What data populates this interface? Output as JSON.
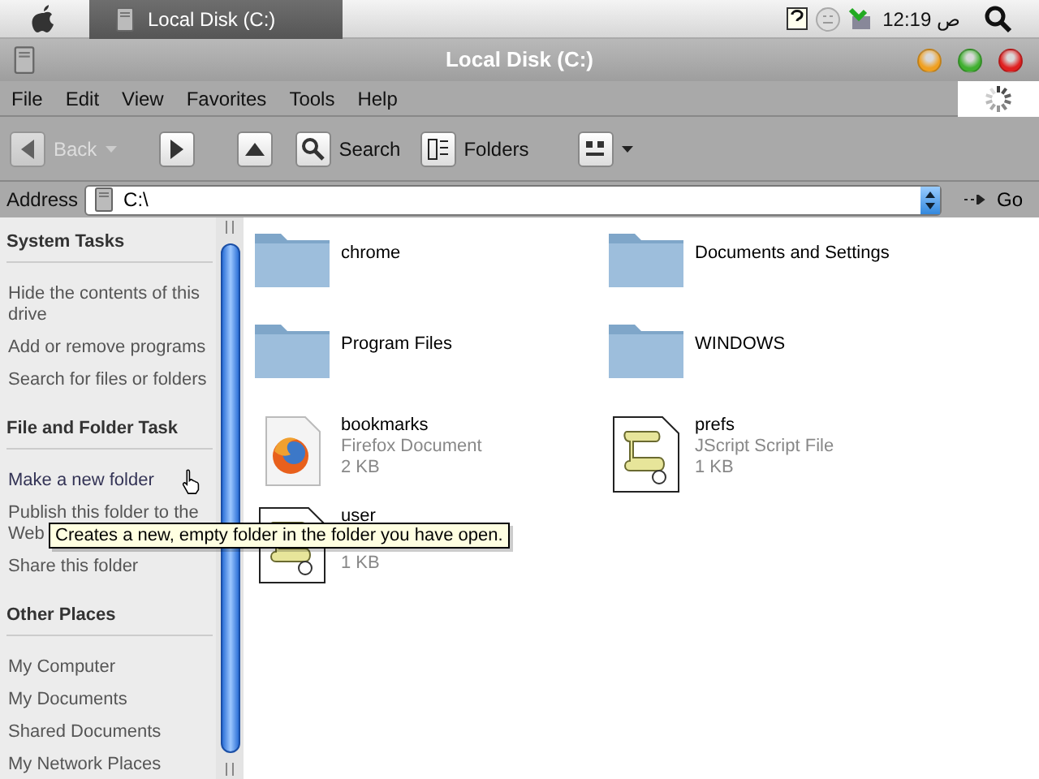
{
  "top_bar": {
    "task": {
      "label": "Local Disk (C:)",
      "selected": true
    },
    "clock": "12:19 ص"
  },
  "window": {
    "title": "Local Disk (C:)"
  },
  "menu": [
    "File",
    "Edit",
    "View",
    "Favorites",
    "Tools",
    "Help"
  ],
  "toolbar": [
    {
      "kind": "back",
      "label": "Back",
      "disabled": true
    },
    {
      "kind": "forward",
      "disabled": false
    },
    {
      "kind": "up",
      "disabled": false
    },
    {
      "kind": "search",
      "label": "Search",
      "disabled": false
    },
    {
      "kind": "folders",
      "label": "Folders",
      "disabled": false
    },
    {
      "kind": "views",
      "disabled": false
    }
  ],
  "address": {
    "label": "Address",
    "value": "C:\\",
    "go": "Go"
  },
  "sidebar": [
    {
      "title": "System Tasks",
      "items": [
        {
          "label": "Hide the contents of this drive",
          "hover": false
        },
        {
          "label": "Add or remove programs",
          "hover": false
        },
        {
          "label": "Search for files or folders",
          "hover": false
        }
      ]
    },
    {
      "title": "File and Folder Task",
      "items": [
        {
          "label": "Make a new folder",
          "hover": true
        },
        {
          "label": "Publish this folder to the Web",
          "hover": false
        },
        {
          "label": "Share this folder",
          "hover": false
        }
      ]
    },
    {
      "title": "Other Places",
      "items": [
        {
          "label": "My Computer",
          "hover": false
        },
        {
          "label": "My Documents",
          "hover": false
        },
        {
          "label": "Shared Documents",
          "hover": false
        },
        {
          "label": "My Network Places",
          "hover": false
        }
      ]
    }
  ],
  "files": [
    {
      "kind": "folder",
      "name": "chrome"
    },
    {
      "kind": "folder",
      "name": "Documents and Settings"
    },
    {
      "kind": "folder",
      "name": "Program Files"
    },
    {
      "kind": "folder",
      "name": "WINDOWS"
    },
    {
      "kind": "firefox",
      "name": "bookmarks",
      "type": "Firefox Document",
      "size": "2 KB"
    },
    {
      "kind": "script",
      "name": "prefs",
      "type": "JScript Script File",
      "size": "1 KB"
    },
    {
      "kind": "script",
      "name": "user",
      "size": "1 KB"
    }
  ],
  "tooltip": "Creates a new, empty folder in the folder you have open."
}
